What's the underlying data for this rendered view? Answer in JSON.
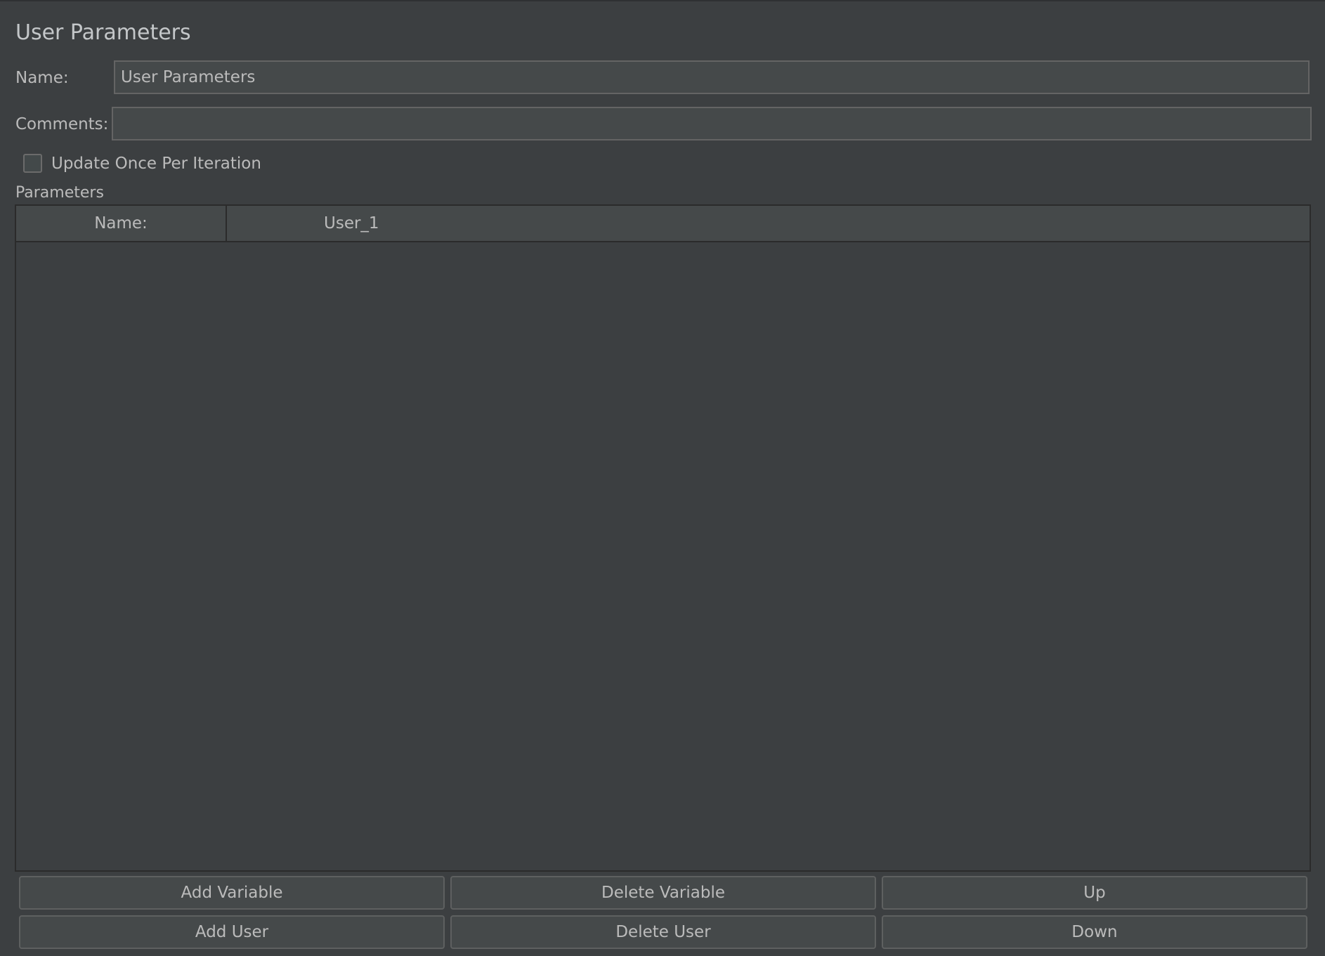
{
  "panel": {
    "title": "User Parameters"
  },
  "name_field": {
    "label": "Name:",
    "value": "User Parameters"
  },
  "comments_field": {
    "label": "Comments:",
    "value": ""
  },
  "update_option": {
    "label": "Update Once Per Iteration",
    "checked": false
  },
  "parameters": {
    "section_label": "Parameters",
    "columns": [
      "Name:",
      "User_1"
    ],
    "rows": []
  },
  "buttons": {
    "add_variable": "Add Variable",
    "delete_variable": "Delete Variable",
    "up": "Up",
    "add_user": "Add User",
    "delete_user": "Delete User",
    "down": "Down"
  },
  "colors": {
    "background": "#3c3f41",
    "field_background": "#45494a",
    "text": "#bbbbbb"
  }
}
